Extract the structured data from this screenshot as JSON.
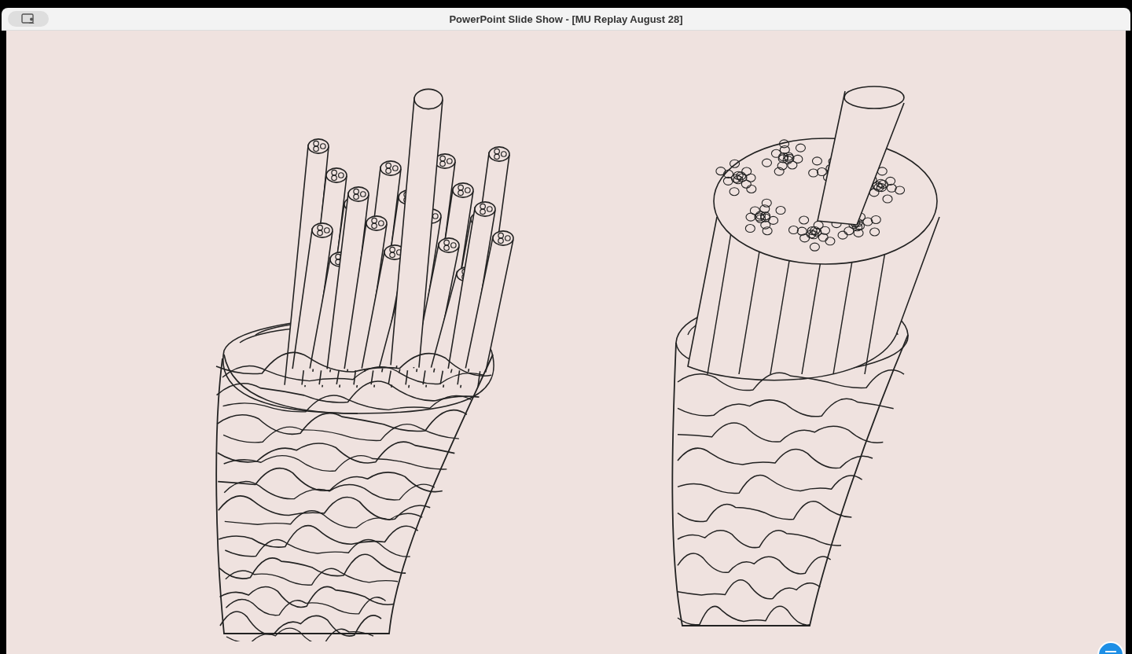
{
  "window": {
    "title": "PowerPoint Slide Show - [MU Replay August 28]"
  }
}
